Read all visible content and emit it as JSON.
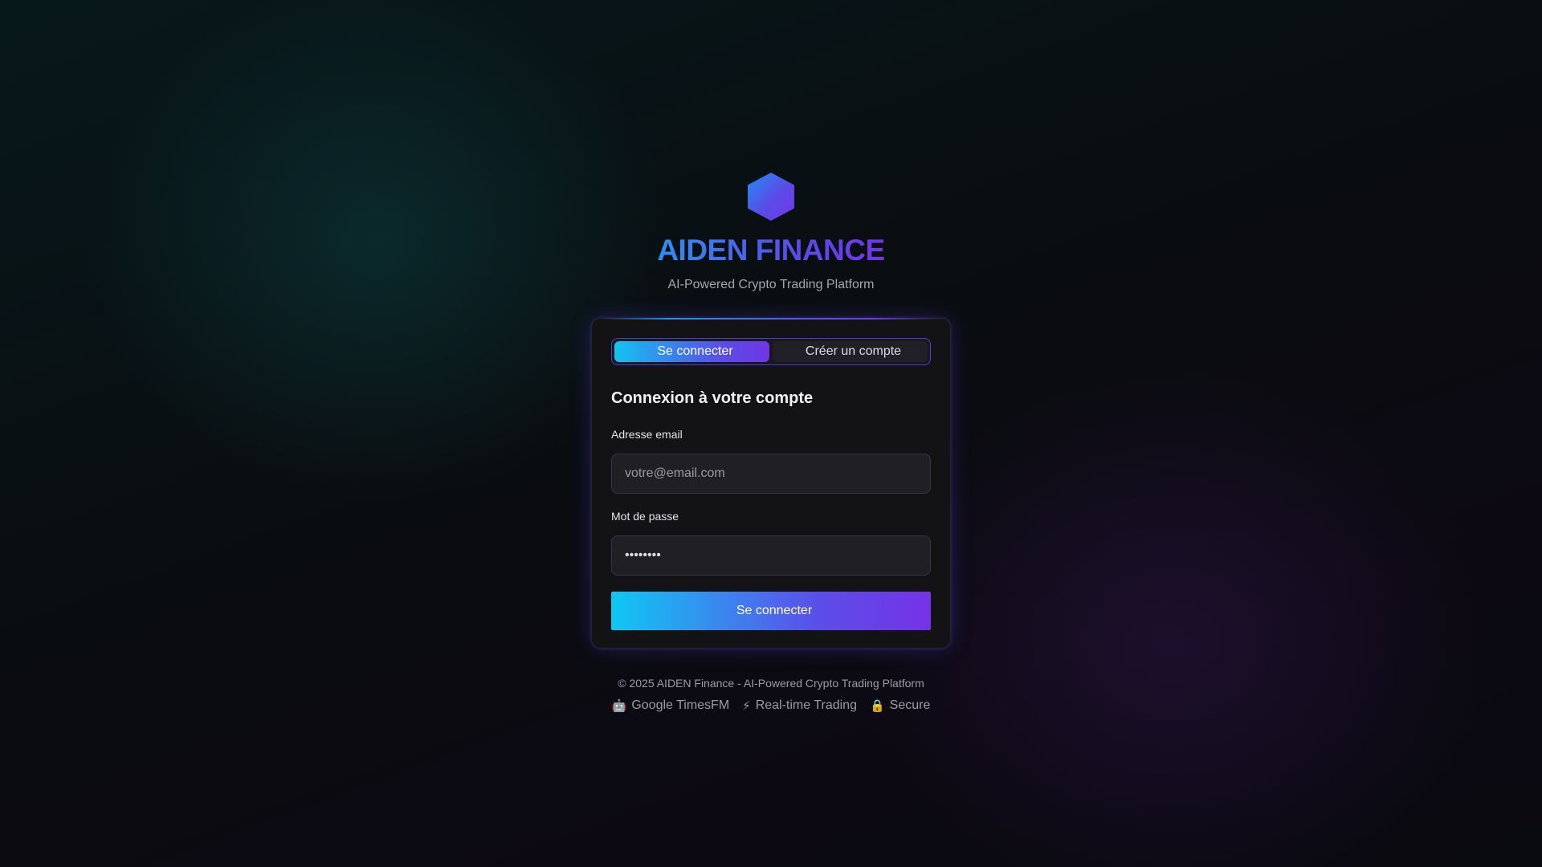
{
  "brand": {
    "logo_icon": "hexagon-logo-icon",
    "title": "AIDEN FINANCE",
    "subtitle": "AI-Powered Crypto Trading Platform"
  },
  "tabs": [
    {
      "label": "Se connecter",
      "icon": "sign-in-icon",
      "icon_glyph": "",
      "active": true
    },
    {
      "label": "Créer un compte",
      "icon": "user-plus-icon",
      "icon_glyph": "",
      "active": false
    }
  ],
  "form": {
    "title": "Connexion à votre compte",
    "email": {
      "label": "Adresse email",
      "placeholder": "votre@email.com",
      "value": ""
    },
    "password": {
      "label": "Mot de passe",
      "value": "••••••••"
    },
    "submit": {
      "label": "Se connecter",
      "icon": "sign-in-icon",
      "icon_glyph": ""
    }
  },
  "footer": {
    "copyright": "© 2025 AIDEN Finance - AI-Powered Crypto Trading Platform",
    "features": [
      {
        "icon": "robot-icon",
        "glyph": "🤖",
        "label": "Google TimesFM"
      },
      {
        "icon": "lightning-icon",
        "glyph": "⚡",
        "label": "Real-time Trading"
      },
      {
        "icon": "lock-icon",
        "glyph": "🔒",
        "label": "Secure"
      }
    ]
  },
  "colors": {
    "accent_cyan": "#13c3f0",
    "accent_blue": "#2f8ff0",
    "accent_purple": "#7036e6",
    "card_bg": "#131316",
    "page_bg": "#0a0d10"
  }
}
